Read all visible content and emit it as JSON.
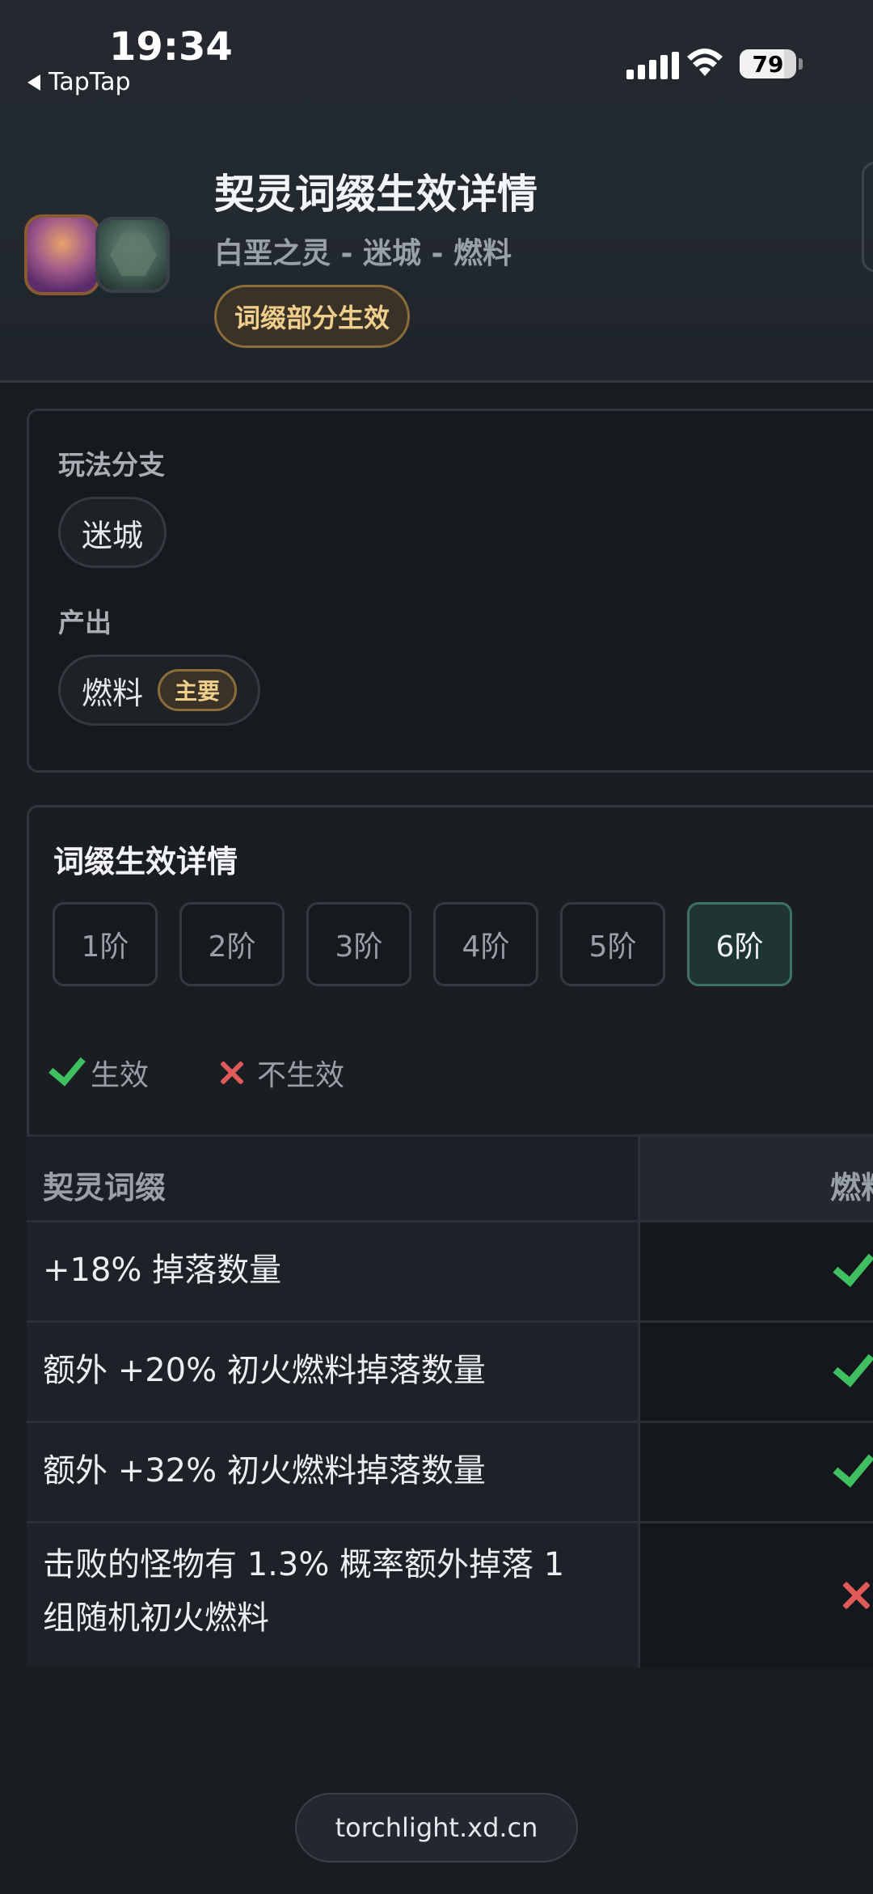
{
  "status_bar": {
    "time": "19:34",
    "back_app": "TapTap",
    "battery": "79",
    "battery_level": 0.79
  },
  "header": {
    "title": "契灵词缀生效详情",
    "subtitle": "白垩之灵 - 迷城 - 燃料",
    "badge": "词缀部分生效",
    "avatars": [
      "character-portrait",
      "map-portrait"
    ]
  },
  "branch_card": {
    "branch_label": "玩法分支",
    "branch_value": "迷城",
    "output_label": "产出",
    "output_value": "燃料",
    "output_tag": "主要"
  },
  "detail_card": {
    "title": "词缀生效详情",
    "tiers": [
      "1阶",
      "2阶",
      "3阶",
      "4阶",
      "5阶",
      "6阶"
    ],
    "active_tier_index": 5,
    "legend_effective": "生效",
    "legend_ineffective": "不生效",
    "table": {
      "col_affix": "契灵词缀",
      "col_output": "燃料",
      "rows": [
        {
          "affix": "+18% 掉落数量",
          "effective": true
        },
        {
          "affix": "额外 +20% 初火燃料掉落数量",
          "effective": true
        },
        {
          "affix": "额外 +32% 初火燃料掉落数量",
          "effective": true
        },
        {
          "affix": "击败的怪物有 1.3% 概率额外掉落 1 组随机初火燃料",
          "effective": false
        }
      ]
    }
  },
  "url_bar": {
    "url": "torchlight.xd.cn"
  },
  "colors": {
    "accent_gold": "#f0cf8c",
    "effective_green": "#3fbf5f",
    "ineffective_red": "#e05a5a",
    "active_tier_bg": "#1f3532"
  }
}
